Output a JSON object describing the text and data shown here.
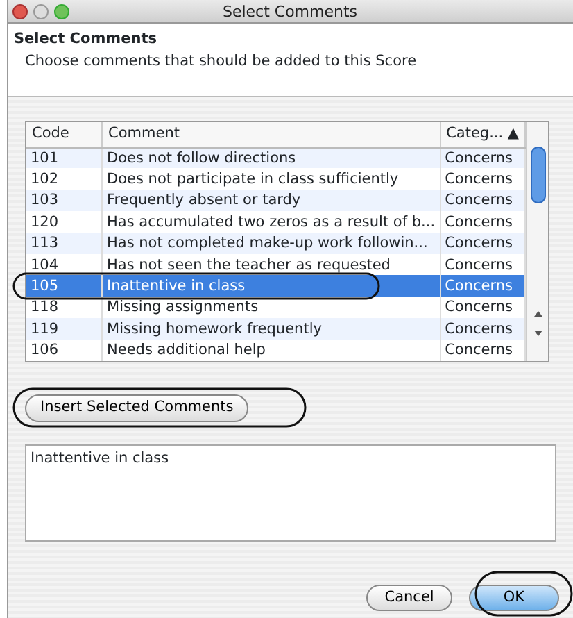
{
  "window": {
    "title": "Select Comments"
  },
  "header": {
    "title": "Select Comments",
    "subtitle": "Choose comments that should be added to this Score"
  },
  "table": {
    "columns": [
      "Code",
      "Comment",
      "Categ... ▲"
    ],
    "rows": [
      {
        "cells": [
          "101",
          "Does not follow directions",
          "Concerns"
        ],
        "selected": false
      },
      {
        "cells": [
          "102",
          "Does not participate in class sufficiently",
          "Concerns"
        ],
        "selected": false
      },
      {
        "cells": [
          "103",
          "Frequently absent or tardy",
          "Concerns"
        ],
        "selected": false
      },
      {
        "cells": [
          "120",
          "Has accumulated two zeros as a result of b...",
          "Concerns"
        ],
        "selected": false
      },
      {
        "cells": [
          "113",
          "Has not completed make-up work followin...",
          "Concerns"
        ],
        "selected": false
      },
      {
        "cells": [
          "104",
          "Has not seen the teacher as requested",
          "Concerns"
        ],
        "selected": false
      },
      {
        "cells": [
          "105",
          "Inattentive in class",
          "Concerns"
        ],
        "selected": true
      },
      {
        "cells": [
          "118",
          "Missing assignments",
          "Concerns"
        ],
        "selected": false
      },
      {
        "cells": [
          "119",
          "Missing homework frequently",
          "Concerns"
        ],
        "selected": false
      },
      {
        "cells": [
          "106",
          "Needs additional help",
          "Concerns"
        ],
        "selected": false
      }
    ]
  },
  "insert_button": "Insert Selected Comments",
  "comment_text": "Inattentive in class",
  "buttons": [
    {
      "label": "Cancel",
      "kind": "normal"
    },
    {
      "label": "OK",
      "kind": "default"
    }
  ]
}
